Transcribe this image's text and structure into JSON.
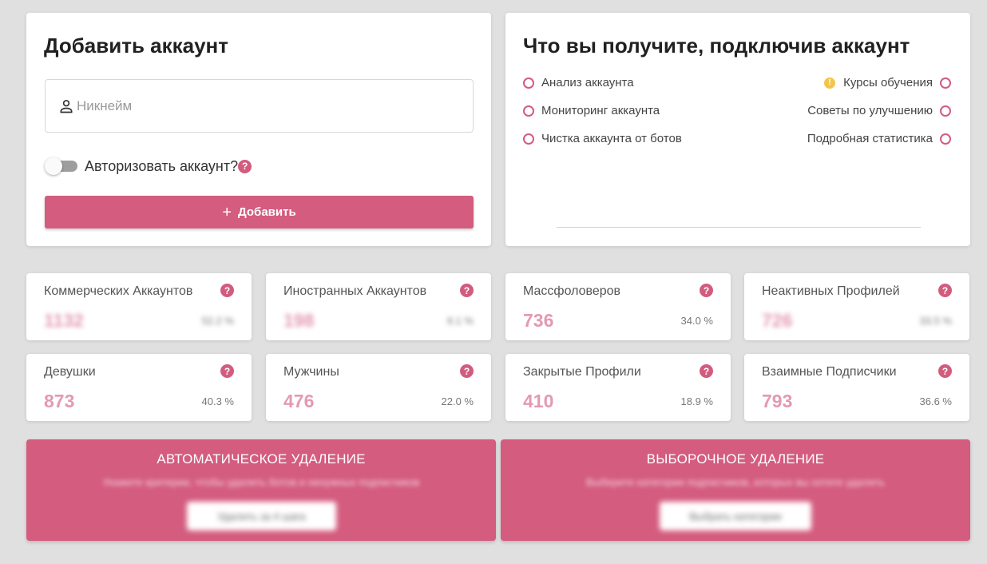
{
  "add_account": {
    "title": "Добавить аккаунт",
    "nickname_placeholder": "Никнейм",
    "authorize_label": "Авторизовать аккаунт?",
    "add_button_label": "Добавить"
  },
  "benefits": {
    "title": "Что вы получите, подключив аккаунт",
    "left": [
      "Анализ аккаунта",
      "Мониторинг аккаунта",
      "Чистка аккаунта от ботов"
    ],
    "right": [
      "Курсы обучения",
      "Советы по улучшению",
      "Подробная статистика"
    ]
  },
  "stats": [
    {
      "label": "Коммерческих Аккаунтов",
      "value": "1132",
      "percent": "52.2 %",
      "blurred": true
    },
    {
      "label": "Иностранных Аккаунтов",
      "value": "198",
      "percent": "9.1 %",
      "blurred": true
    },
    {
      "label": "Массфоловеров",
      "value": "736",
      "percent": "34.0 %",
      "blurred": false
    },
    {
      "label": "Неактивных Профилей",
      "value": "726",
      "percent": "33.5 %",
      "blurred": true
    },
    {
      "label": "Девушки",
      "value": "873",
      "percent": "40.3 %",
      "blurred": false
    },
    {
      "label": "Мужчины",
      "value": "476",
      "percent": "22.0 %",
      "blurred": false
    },
    {
      "label": "Закрытые Профили",
      "value": "410",
      "percent": "18.9 %",
      "blurred": false
    },
    {
      "label": "Взаимные Подписчики",
      "value": "793",
      "percent": "36.6 %",
      "blurred": false
    }
  ],
  "actions": {
    "auto": {
      "title": "АВТОМАТИЧЕСКОЕ УДАЛЕНИЕ",
      "description": "Укажите критерии, чтобы удалить ботов и ненужных подписчиков",
      "button": "Удалить за 4 шага"
    },
    "selective": {
      "title": "ВЫБОРОЧНОЕ УДАЛЕНИЕ",
      "description": "Выберите категории подписчиков, которых вы хотите удалить",
      "button": "Выбрать категории"
    }
  },
  "colors": {
    "accent": "#d45c7f",
    "background": "#e0e0e0",
    "warning": "#f3c549"
  }
}
